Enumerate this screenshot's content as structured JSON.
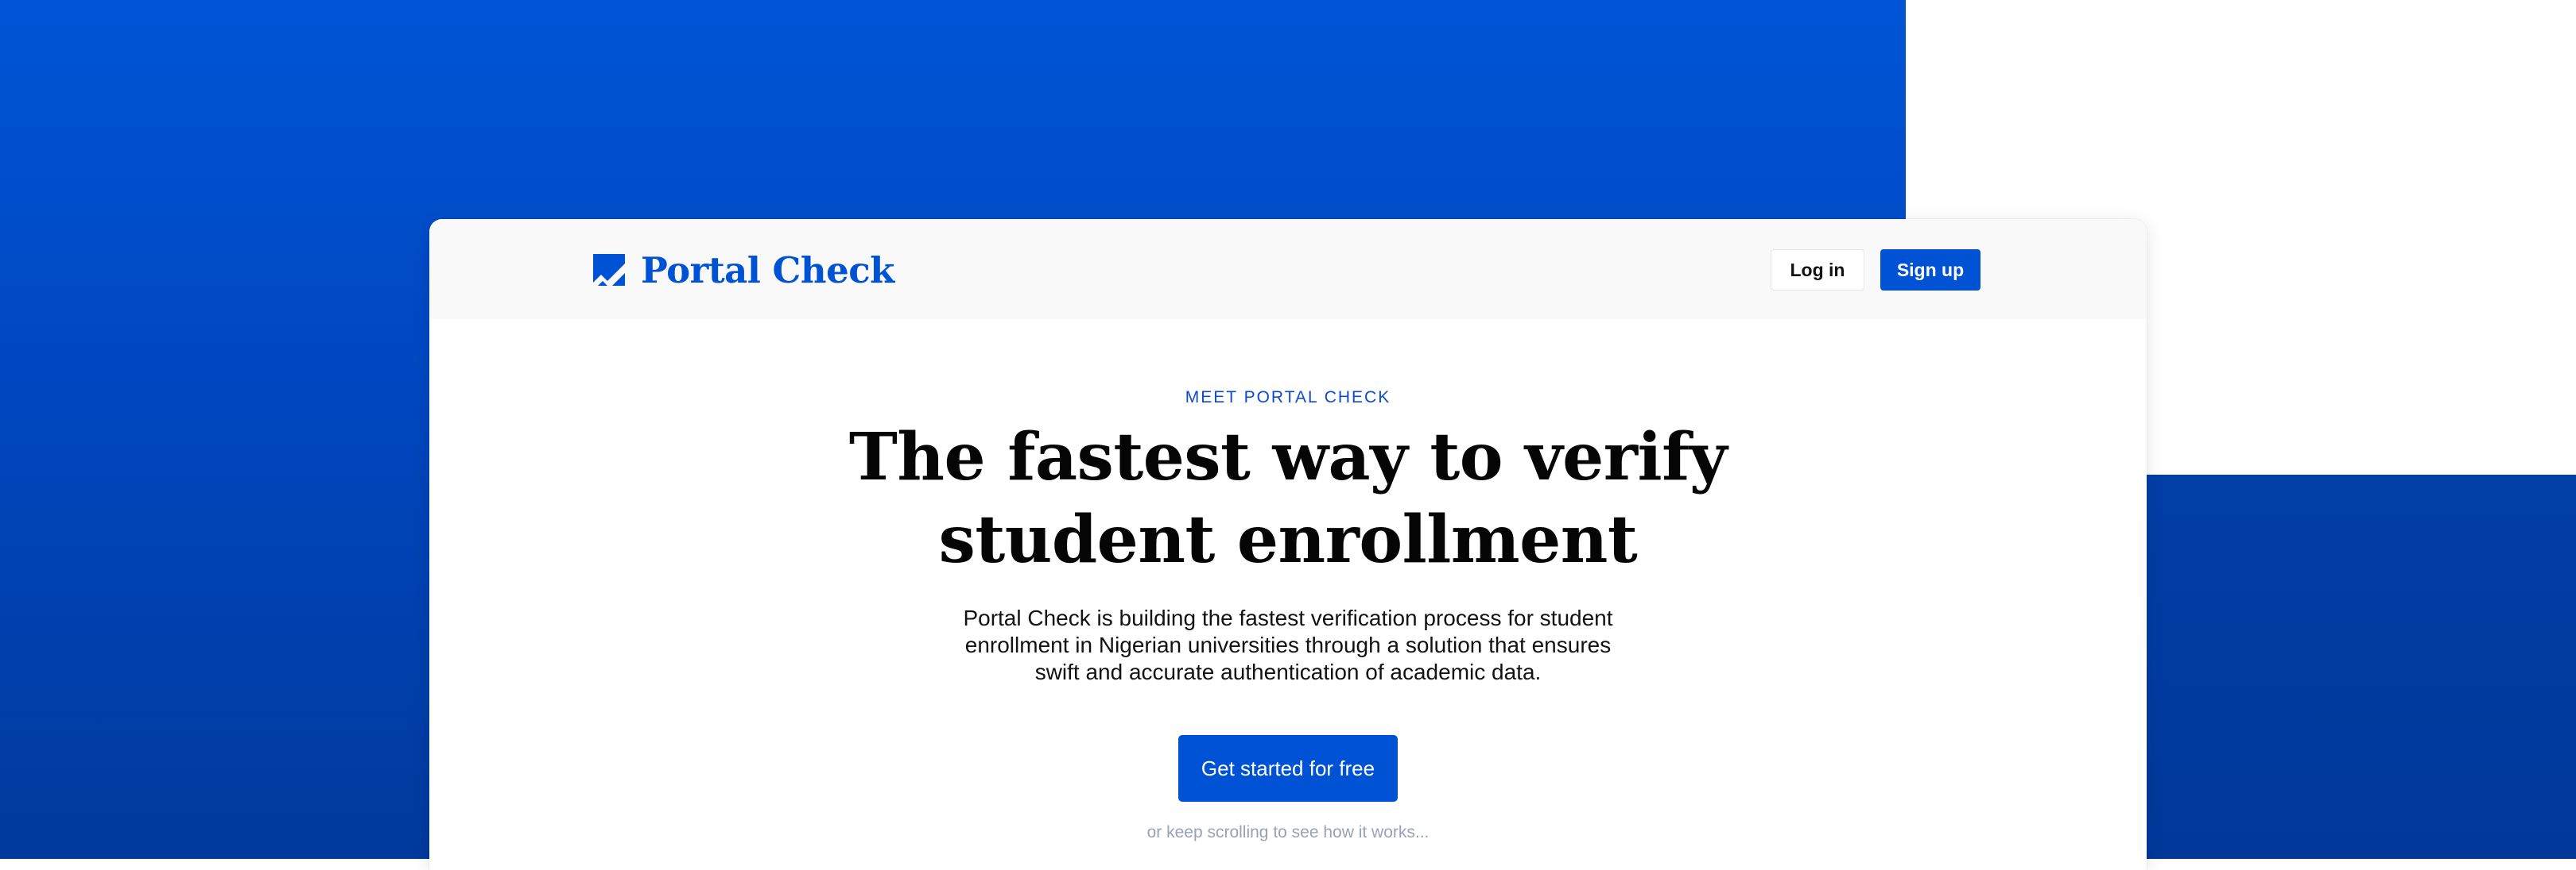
{
  "colors": {
    "brand": "#0052d4",
    "background_gradient_top": "#0055d6",
    "background_gradient_bottom": "#013a9c",
    "navbar_bg": "#f9f9f9",
    "muted_text": "#9aa1b4"
  },
  "nav": {
    "brand_name": "Portal Check",
    "logo_icon": "checkbox-check-icon",
    "login_label": "Log in",
    "signup_label": "Sign up"
  },
  "hero": {
    "eyebrow": "MEET PORTAL CHECK",
    "headline_line1": "The fastest way to verify",
    "headline_line2": "student enrollment",
    "description": "Portal Check is building the fastest verification process for student enrollment in Nigerian universities through a solution that ensures swift and accurate authentication of academic data.",
    "cta_label": "Get started for free",
    "scroll_hint": "or keep scrolling to see how it works..."
  }
}
